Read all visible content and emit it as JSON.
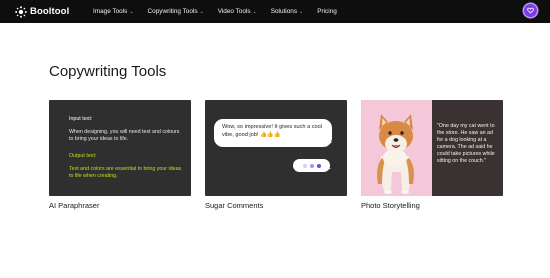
{
  "brand": {
    "name": "Booltool"
  },
  "nav": {
    "items": [
      {
        "label": "Image Tools",
        "dropdown": true
      },
      {
        "label": "Copywriting Tools",
        "dropdown": true
      },
      {
        "label": "Video Tools",
        "dropdown": true
      },
      {
        "label": "Solutions",
        "dropdown": true
      },
      {
        "label": "Pricing",
        "dropdown": false
      }
    ],
    "chevron": "⌄"
  },
  "page": {
    "title": "Copywriting Tools"
  },
  "cards": [
    {
      "name": "AI Paraphraser",
      "input_label": "Input text:",
      "input_text": "When designing, you will need text and colours to bring your ideas to life.",
      "output_label": "Output text:",
      "output_text": "Text and colors are essential to bring your ideas to life when creating."
    },
    {
      "name": "Sugar Comments",
      "comment": "Wow, so impressive! It gives such a cool vibe, good job! 👍👍👍"
    },
    {
      "name": "Photo Storytelling",
      "story": "\"One day my cat went to the store. He saw an ad for a dog looking at a camera. The ad said he could take pictures while sitting on the couch.\""
    }
  ],
  "colors": {
    "nav_bg": "#0e0e0e",
    "accent_purple": "#7b3ee6",
    "output_green": "#b9e61e",
    "card_dark": "#2f2f2f",
    "photo_bg": "#f4c8d8"
  },
  "icons": {
    "logo": "booltool-logo-icon",
    "avatar": "user-heart-avatar-icon"
  }
}
